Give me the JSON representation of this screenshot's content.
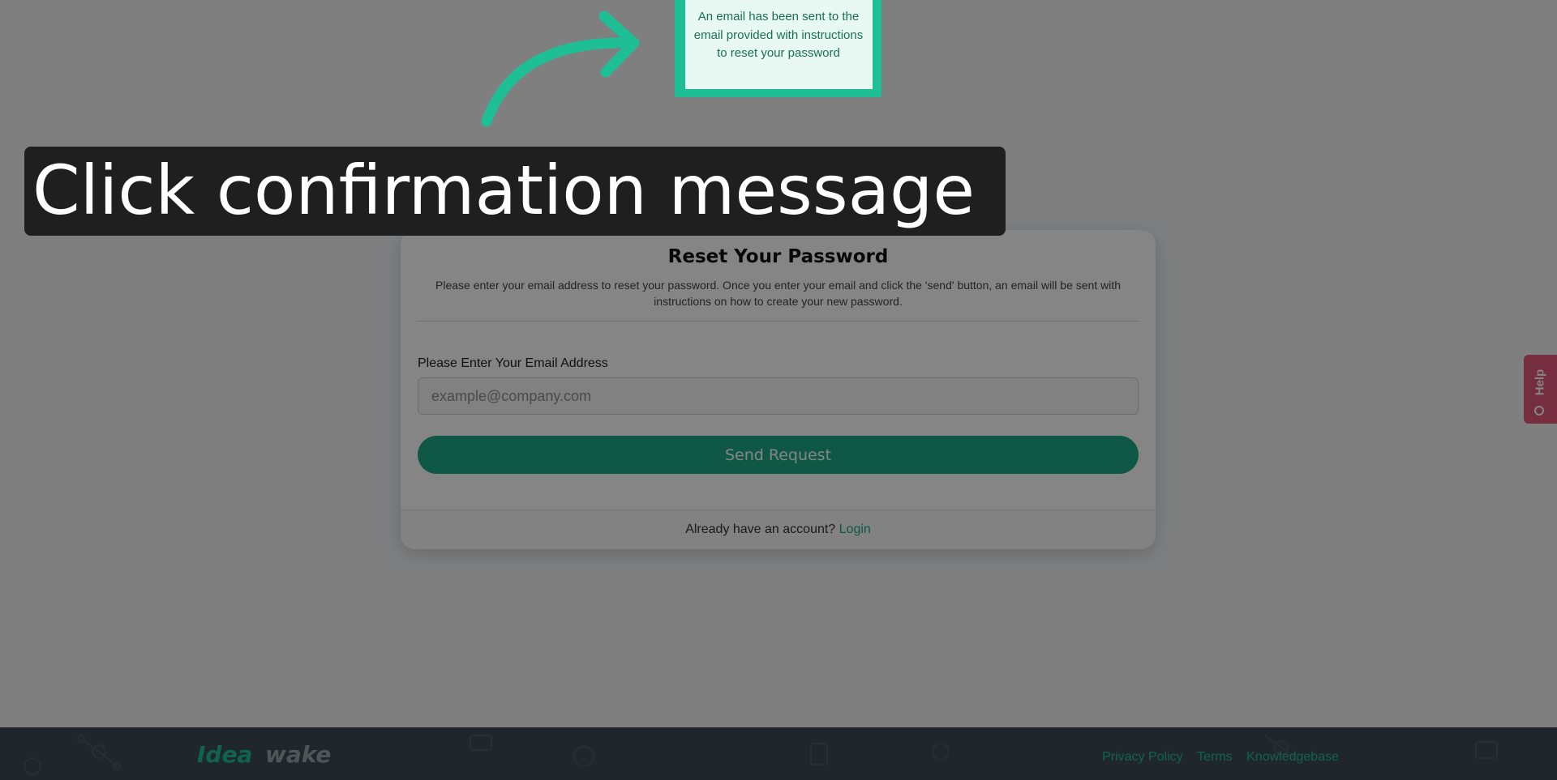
{
  "reset_card": {
    "title": "Reset Your Password",
    "description": "Please enter your email address to reset your password. Once you enter your email and click the 'send' button, an email will be sent with instructions on how to create your new password.",
    "email_label": "Please Enter Your Email Address",
    "email_placeholder": "example@company.com",
    "email_value": "",
    "send_button": "Send Request",
    "footer_text": "Already have an account?",
    "login_link": "Login"
  },
  "confirmation_message": "An email has been sent to the email provided with instructions to reset your password",
  "caption": "Click confirmation message",
  "help_tab": {
    "label": "Help",
    "icon": "lifebuoy-icon"
  },
  "footer": {
    "logo": "Ideawake",
    "links": [
      "Privacy Policy",
      "Terms",
      "Knowledgebase"
    ]
  },
  "colors": {
    "brand_green": "#1ea985",
    "help_pink": "#e0577a",
    "footer_bg": "#3d4b55",
    "caption_bg": "#1f1f1f"
  }
}
